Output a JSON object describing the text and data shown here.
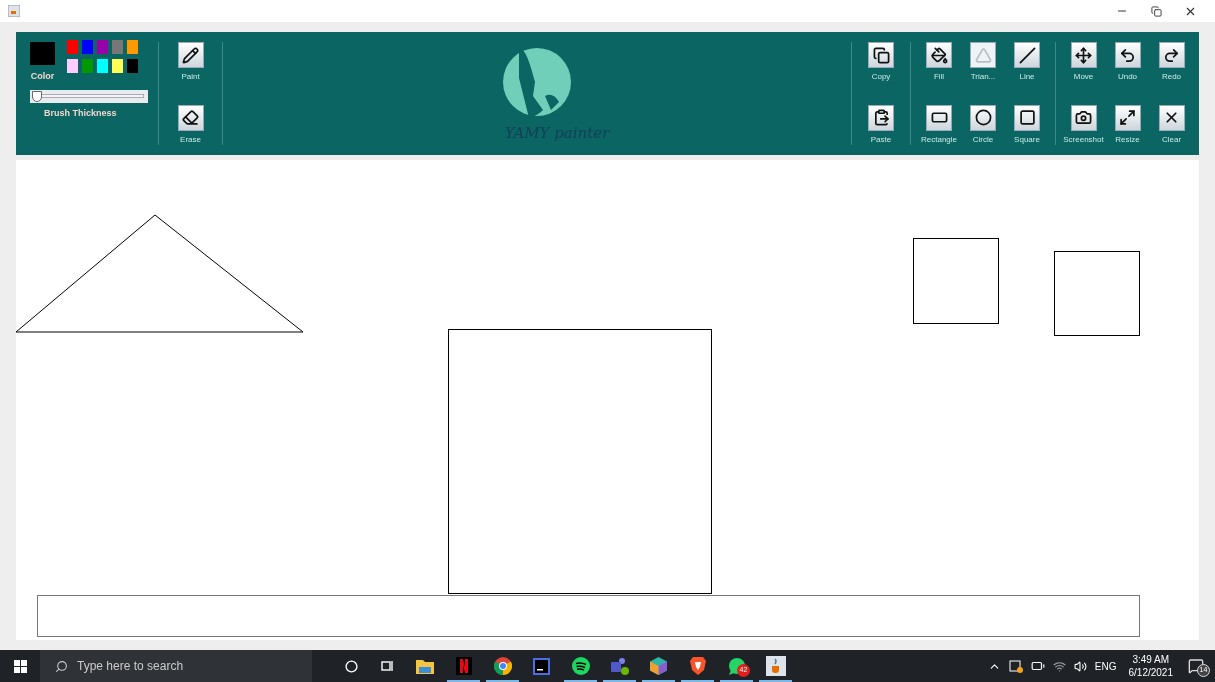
{
  "toolbar": {
    "current": {
      "color": "#000000"
    },
    "color_label": "Color",
    "palette": [
      {
        "color": "#ff0000"
      },
      {
        "color": "#0000ff"
      },
      {
        "color": "#9900aa"
      },
      {
        "color": "#777777"
      },
      {
        "color": "#ff9900"
      },
      {
        "color": "#ffccff"
      },
      {
        "color": "#009900"
      },
      {
        "color": "#00ffff"
      },
      {
        "color": "#ffff55"
      },
      {
        "color": "#000000"
      }
    ],
    "brush": {
      "level": 0.02,
      "label": "Brush Thickness"
    },
    "tool_groups": [
      {
        "tools": [
          {
            "kind": "paint",
            "label": "Paint",
            "selected": false
          },
          {
            "kind": "erase",
            "label": "Erase",
            "selected": false
          }
        ]
      },
      {
        "tools": [
          {
            "kind": "copy",
            "label": "Copy",
            "selected": false
          },
          {
            "kind": "paste",
            "label": "Paste",
            "selected": false
          }
        ]
      },
      {
        "tools": [
          {
            "kind": "fill",
            "label": "Fill",
            "selected": false
          },
          {
            "kind": "triangle",
            "label": "Trian...",
            "selected": true
          },
          {
            "kind": "line",
            "label": "Line",
            "selected": false
          },
          {
            "kind": "rectangle",
            "label": "Rectangle",
            "selected": false
          },
          {
            "kind": "circle",
            "label": "Circle",
            "selected": false
          },
          {
            "kind": "square",
            "label": "Square",
            "selected": false
          }
        ]
      },
      {
        "tools": [
          {
            "kind": "move",
            "label": "Move",
            "selected": false
          },
          {
            "kind": "undo",
            "label": "Undo",
            "selected": false
          },
          {
            "kind": "redo",
            "label": "Redo",
            "selected": false
          },
          {
            "kind": "screenshot",
            "label": "Screenshot",
            "selected": false
          },
          {
            "kind": "resize",
            "label": "Resize",
            "selected": false
          },
          {
            "kind": "clear",
            "label": "Clear",
            "selected": false
          }
        ]
      }
    ],
    "logo": {
      "text": "YAMY painter"
    }
  },
  "canvas": {
    "shapes": [
      {
        "kind": "triangle"
      },
      {
        "kind": "square"
      },
      {
        "kind": "square"
      },
      {
        "kind": "square"
      }
    ]
  },
  "taskbar": {
    "search_placeholder": "Type here to search",
    "apps": [
      {
        "kind": "explorer",
        "running": false
      },
      {
        "kind": "netflix",
        "running": true
      },
      {
        "kind": "chrome",
        "running": true
      },
      {
        "kind": "intellij",
        "running": false
      },
      {
        "kind": "spotify",
        "running": true
      },
      {
        "kind": "teams",
        "running": true
      },
      {
        "kind": "cube",
        "running": true
      },
      {
        "kind": "brave",
        "running": true
      },
      {
        "kind": "whatsapp",
        "running": true,
        "badge": "42"
      },
      {
        "kind": "java",
        "running": true
      }
    ],
    "tray": {
      "language": "ENG",
      "time": "3:49 AM",
      "date": "6/12/2021",
      "notifications": "14"
    }
  }
}
